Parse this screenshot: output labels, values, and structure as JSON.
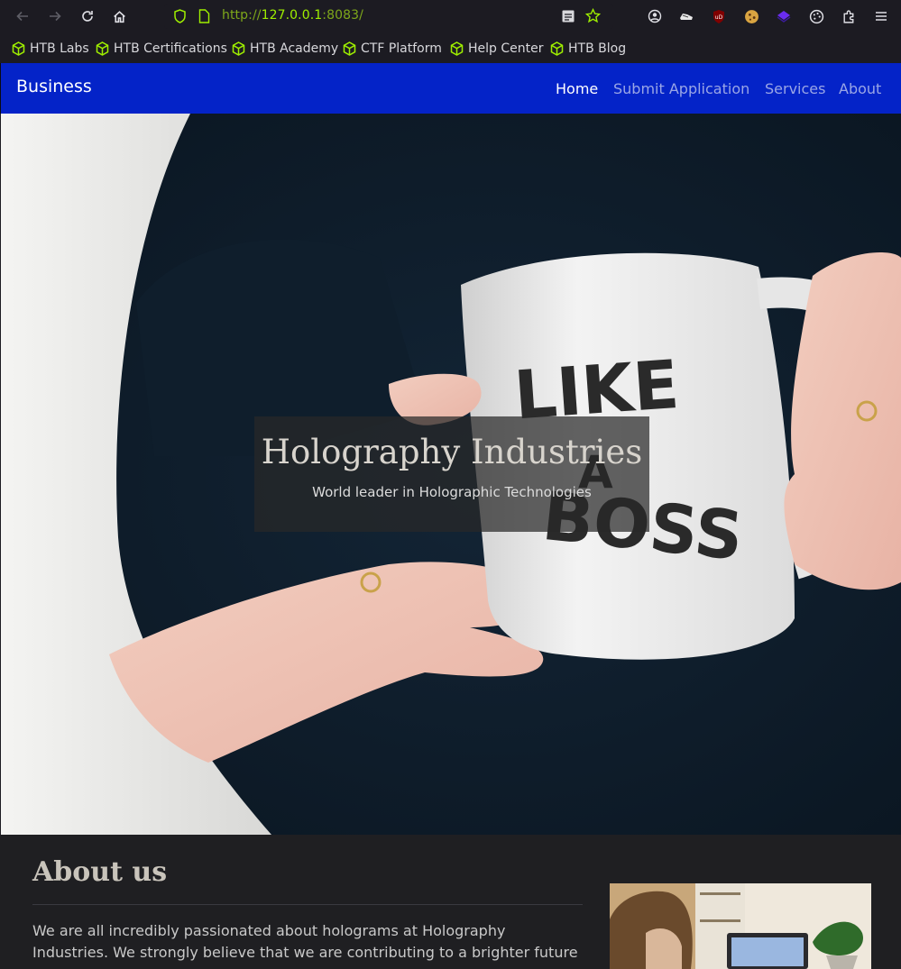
{
  "browser": {
    "url_scheme": "http://",
    "url_host": "127.0.0.1",
    "url_port": ":8083/",
    "bookmarks": [
      {
        "label": "HTB Labs"
      },
      {
        "label": "HTB Certifications"
      },
      {
        "label": "HTB Academy"
      },
      {
        "label": "CTF Platform"
      },
      {
        "label": "Help Center"
      },
      {
        "label": "HTB Blog"
      }
    ],
    "accent_color": "#9fef00"
  },
  "navbar": {
    "brand": "Business",
    "links": [
      {
        "label": "Home",
        "active": true
      },
      {
        "label": "Submit Application",
        "active": false
      },
      {
        "label": "Services",
        "active": false
      },
      {
        "label": "About",
        "active": false
      }
    ],
    "color": "#0423c8"
  },
  "hero": {
    "title": "Holography Industries",
    "subtitle": "World leader in Holographic Technologies",
    "mug_text": [
      "LIKE",
      "A",
      "BOSS"
    ]
  },
  "about": {
    "title": "About us",
    "text": "We are all incredibly passionated about holograms at Holography Industries. We strongly believe that we are contributing to a brighter future"
  }
}
